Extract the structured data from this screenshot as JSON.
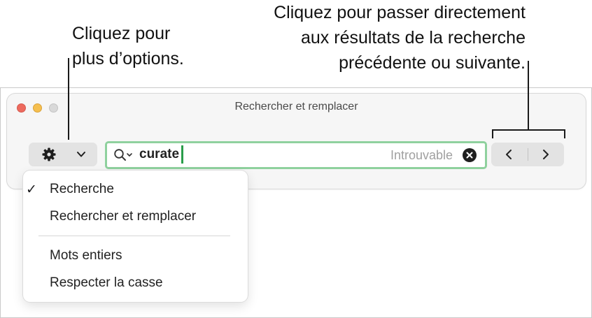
{
  "callouts": {
    "options": {
      "line1": "Cliquez pour",
      "line2": "plus d’options."
    },
    "navigation": {
      "line1": "Cliquez pour passer directement",
      "line2": "aux résultats de la recherche",
      "line3": "précédente ou suivante."
    }
  },
  "window": {
    "title": "Rechercher et remplacer"
  },
  "search": {
    "value": "curate",
    "status": "Introuvable"
  },
  "menu": {
    "checkmark": "✓",
    "items": [
      {
        "label": "Recherche",
        "checked": true
      },
      {
        "label": "Rechercher et remplacer",
        "checked": false
      },
      {
        "label": "Mots entiers",
        "checked": false
      },
      {
        "label": "Respecter la casse",
        "checked": false
      }
    ]
  },
  "icons": [
    "gear-icon",
    "chevron-down-icon",
    "magnifier-icon",
    "clear-icon",
    "chevron-left-icon",
    "chevron-right-icon"
  ],
  "colors": {
    "focus_ring": "#8fd19e",
    "caret": "#2a9d4a",
    "close": "#ed6a5e",
    "minimize": "#f5bf4f"
  }
}
